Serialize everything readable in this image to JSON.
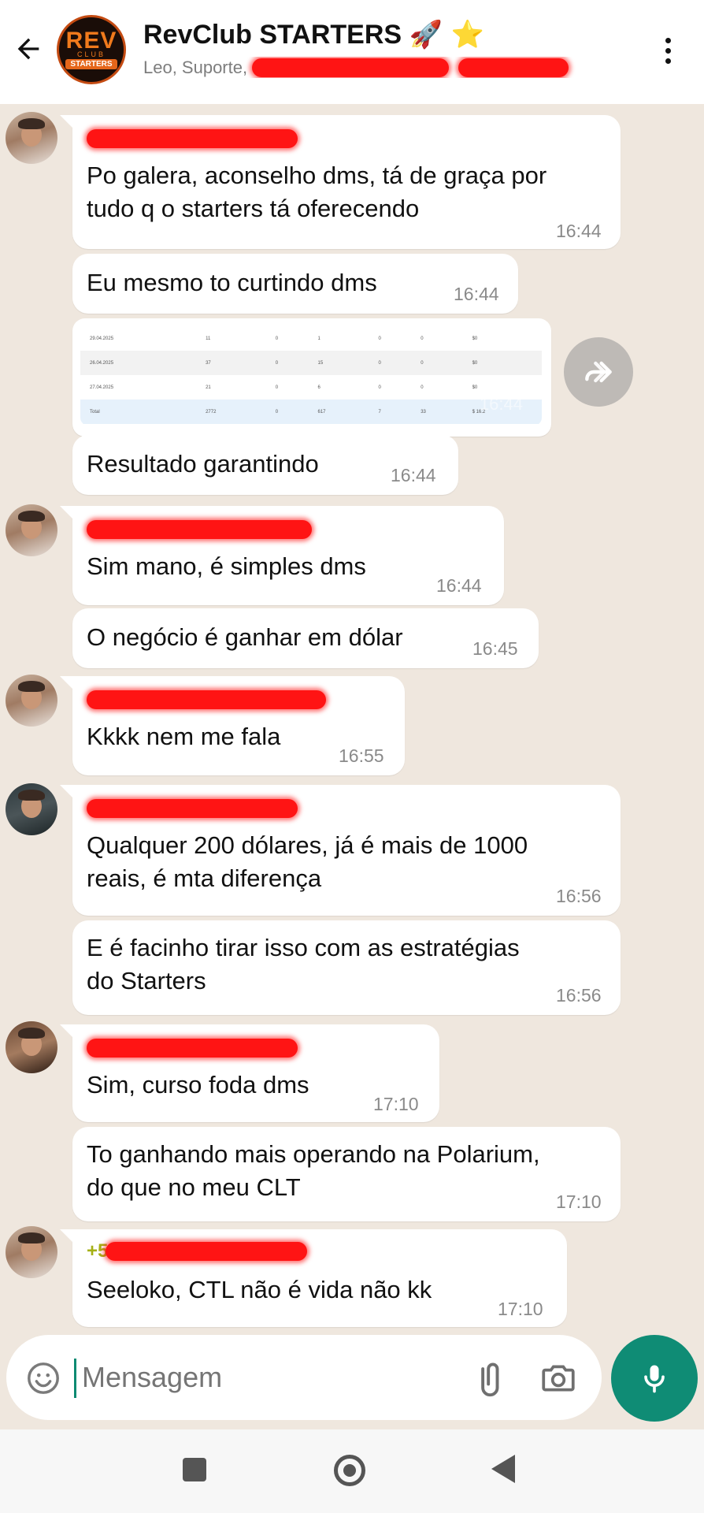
{
  "header": {
    "title": "RevClub STARTERS",
    "title_emoji": "🚀 ⭐",
    "subtitle": "Leo, Suporte, ",
    "logo": {
      "rev": "REV",
      "club": "CLUB",
      "starters": "STARTERS"
    }
  },
  "image_table": [
    [
      "29.04.2025",
      "11",
      "0",
      "1",
      "0",
      "0",
      "$0"
    ],
    [
      "26.04.2025",
      "37",
      "0",
      "15",
      "0",
      "0",
      "$0"
    ],
    [
      "27.04.2025",
      "21",
      "0",
      "6",
      "0",
      "0",
      "$0"
    ],
    [
      "Total",
      "2772",
      "0",
      "617",
      "7",
      "33",
      "$ 16.2"
    ]
  ],
  "messages": [
    {
      "text_lines": [
        "Po galera, aconselho dms, tá de graça por",
        "tudo q o starters tá oferecendo"
      ],
      "time": "16:44"
    },
    {
      "text_lines": [
        "Eu mesmo to curtindo dms"
      ],
      "time": "16:44"
    },
    {
      "time": "16:44"
    },
    {
      "text_lines": [
        "Resultado garantindo"
      ],
      "time": "16:44"
    },
    {
      "text_lines": [
        "Sim mano, é simples dms"
      ],
      "time": "16:44"
    },
    {
      "text_lines": [
        "O negócio é ganhar em dólar"
      ],
      "time": "16:45"
    },
    {
      "text_lines": [
        "Kkkk nem me fala"
      ],
      "time": "16:55"
    },
    {
      "text_lines": [
        "Qualquer 200 dólares, já é mais de 1000",
        "reais, é mta diferença"
      ],
      "time": "16:56"
    },
    {
      "text_lines": [
        "E é facinho tirar isso com as estratégias",
        "do Starters"
      ],
      "time": "16:56"
    },
    {
      "text_lines": [
        "Sim, curso foda dms"
      ],
      "time": "17:10"
    },
    {
      "text_lines": [
        "To ganhando mais operando na Polarium,",
        "do que no meu CLT"
      ],
      "time": "17:10"
    },
    {
      "sender_prefix": "+5",
      "text_lines": [
        "Seeloko, CTL não é vida não kk"
      ],
      "time": "17:10"
    }
  ],
  "input": {
    "placeholder": "Mensagem"
  },
  "icons": [
    "back-arrow-icon",
    "more-vert-icon",
    "forward-icon",
    "emoji-icon",
    "attach-icon",
    "camera-icon",
    "mic-icon",
    "nav-recents-icon",
    "nav-home-icon",
    "nav-back-icon"
  ],
  "colors": {
    "accent": "#0f8c75",
    "background": "#efe7de",
    "bubble": "#ffffff",
    "redaction": "#ff1414"
  }
}
